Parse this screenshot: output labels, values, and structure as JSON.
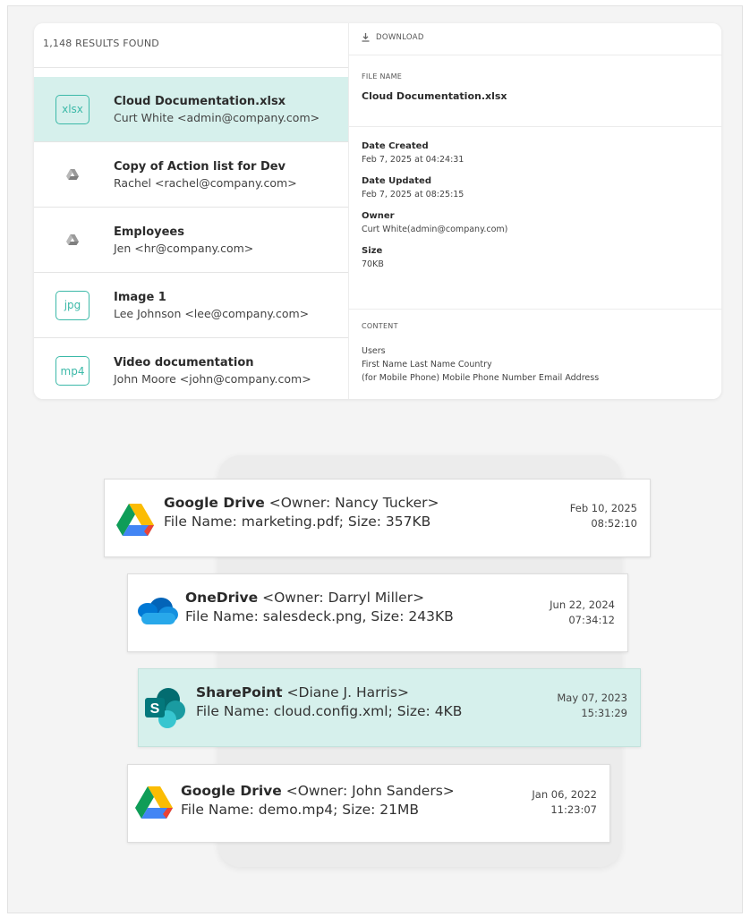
{
  "search": {
    "results_count": "1,148 RESULTS FOUND",
    "results": [
      {
        "type": "badge",
        "badge": "xlsx",
        "title": "Cloud Documentation.xlsx",
        "sub": "Curt White <admin@company.com>",
        "selected": true
      },
      {
        "type": "drive",
        "icon": "google-drive-gray-icon",
        "title": "Copy of Action list for Dev",
        "sub": "Rachel <rachel@company.com>",
        "selected": false
      },
      {
        "type": "drive",
        "icon": "google-drive-gray-icon",
        "title": "Employees",
        "sub": "Jen <hr@company.com>",
        "selected": false
      },
      {
        "type": "badge",
        "badge": "jpg",
        "title": "Image 1",
        "sub": "Lee Johnson <lee@company.com>",
        "selected": false
      },
      {
        "type": "badge",
        "badge": "mp4",
        "title": "Video documentation",
        "sub": "John Moore <john@company.com>",
        "selected": false
      }
    ]
  },
  "details": {
    "download_label": "DOWNLOAD",
    "file_name_label": "FILE NAME",
    "file_name": "Cloud Documentation.xlsx",
    "date_created_label": "Date Created",
    "date_created": "Feb 7, 2025 at 04:24:31",
    "date_updated_label": "Date Updated",
    "date_updated": "Feb 7, 2025 at 08:25:15",
    "owner_label": "Owner",
    "owner": "Curt White(admin@company.com)",
    "size_label": "Size",
    "size": "70KB",
    "content_label": "CONTENT",
    "content_lines": [
      "Users",
      "First Name Last Name Country",
      "(for Mobile Phone) Mobile Phone Number Email Address"
    ]
  },
  "cards": [
    {
      "source": "Google Drive",
      "owner": " <Owner: Nancy Tucker>",
      "file_line": "File Name: marketing.pdf; Size: 357KB",
      "date": "Feb 10, 2025",
      "time": "08:52:10",
      "icon": "google-drive-icon"
    },
    {
      "source": "OneDrive",
      "owner": " <Owner: Darryl Miller>",
      "file_line": "File Name: salesdeck.png, Size: 243KB",
      "date": "Jun 22, 2024",
      "time": "07:34:12",
      "icon": "onedrive-icon"
    },
    {
      "source": "SharePoint",
      "owner": " <Diane J. Harris>",
      "file_line": "File Name: cloud.config.xml; Size: 4KB",
      "date": "May 07, 2023",
      "time": "15:31:29",
      "icon": "sharepoint-icon"
    },
    {
      "source": "Google Drive",
      "owner": " <Owner: John Sanders>",
      "file_line": "File Name: demo.mp4; Size: 21MB",
      "date": "Jan 06, 2022",
      "time": "11:23:07",
      "icon": "google-drive-icon"
    }
  ],
  "colors": {
    "accent_teal": "#3cb9a8",
    "selected_bg": "#d6f0ec"
  }
}
